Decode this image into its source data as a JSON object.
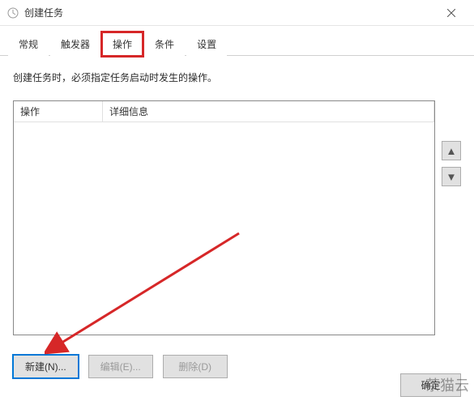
{
  "window": {
    "title": "创建任务",
    "close_label": "×"
  },
  "tabs": [
    {
      "label": "常规",
      "active": false,
      "highlighted": false
    },
    {
      "label": "触发器",
      "active": false,
      "highlighted": false
    },
    {
      "label": "操作",
      "active": true,
      "highlighted": true
    },
    {
      "label": "条件",
      "active": false,
      "highlighted": false
    },
    {
      "label": "设置",
      "active": false,
      "highlighted": false
    }
  ],
  "instruction": "创建任务时，必须指定任务启动时发生的操作。",
  "table": {
    "columns": [
      "操作",
      "详细信息"
    ],
    "rows": []
  },
  "side_buttons": {
    "up": "▲",
    "down": "▼"
  },
  "actions": {
    "new": "新建(N)...",
    "edit": "编辑(E)...",
    "delete": "删除(D)"
  },
  "footer": {
    "ok": "确定"
  },
  "watermark": "茶猫云"
}
